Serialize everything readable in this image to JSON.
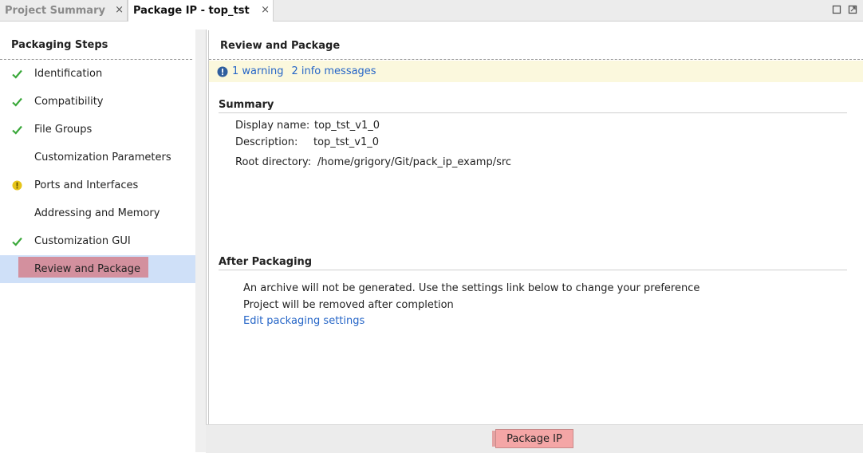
{
  "tabs": [
    {
      "label": "Project Summary",
      "active": false,
      "close": "×"
    },
    {
      "label": "Package IP - top_tst",
      "active": true,
      "close": "×"
    }
  ],
  "window_buttons": [
    "restore-icon",
    "maximize-icon"
  ],
  "left_pane": {
    "title": "Packaging Steps",
    "steps": [
      {
        "label": "Identification",
        "status": "done"
      },
      {
        "label": "Compatibility",
        "status": "done"
      },
      {
        "label": "File Groups",
        "status": "done"
      },
      {
        "label": "Customization Parameters",
        "status": "none"
      },
      {
        "label": "Ports and Interfaces",
        "status": "warning"
      },
      {
        "label": "Addressing and Memory",
        "status": "none"
      },
      {
        "label": "Customization GUI",
        "status": "done"
      },
      {
        "label": "Review and Package",
        "status": "selected"
      }
    ]
  },
  "main": {
    "title": "Review and Package",
    "messages": {
      "warning_link": "1 warning",
      "info_link": "2 info messages"
    },
    "summary": {
      "title": "Summary",
      "display_name_label": "Display name:",
      "display_name_value": "top_tst_v1_0",
      "description_label": "Description:",
      "description_value": "top_tst_v1_0",
      "root_dir_label": "Root directory:",
      "root_dir_value": "/home/grigory/Git/pack_ip_examp/src"
    },
    "after": {
      "title": "After Packaging",
      "line1": "An archive will not be generated. Use the settings link below to change your preference",
      "line2": "Project will be removed after completion",
      "settings_link": "Edit packaging settings"
    }
  },
  "footer": {
    "package_button": "Package IP"
  },
  "colors": {
    "check": "#3aa83a",
    "warning": "#e6c419",
    "info_icon": "#2f5e9e",
    "link": "#2565c7",
    "selected_bg": "#cfe0f8",
    "selected_highlight": "#d3909e",
    "button": "#f4a6a6"
  }
}
